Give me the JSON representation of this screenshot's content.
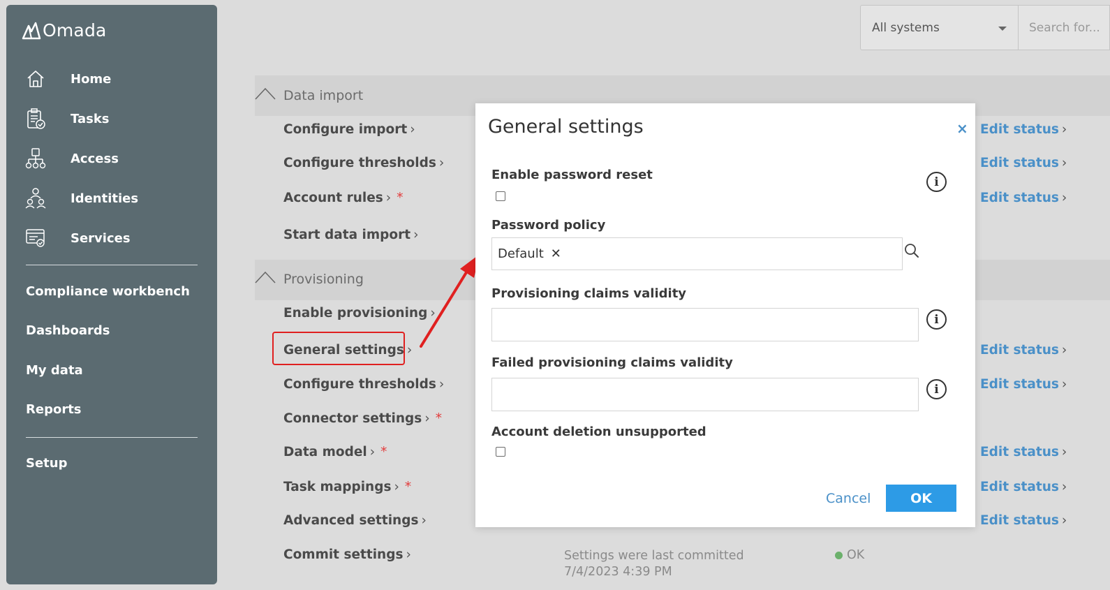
{
  "sidebar": {
    "brand": "Omada",
    "nav": [
      {
        "label": "Home",
        "icon": "home-icon"
      },
      {
        "label": "Tasks",
        "icon": "tasks-icon"
      },
      {
        "label": "Access",
        "icon": "access-icon"
      },
      {
        "label": "Identities",
        "icon": "identities-icon"
      },
      {
        "label": "Services",
        "icon": "services-icon"
      }
    ],
    "links": [
      "Compliance workbench",
      "Dashboards",
      "My data",
      "Reports"
    ],
    "setup": "Setup"
  },
  "topbar": {
    "system_select": "All systems",
    "search_placeholder": "Search for..."
  },
  "sections": {
    "data_import": {
      "title": "Data import",
      "items": [
        "Configure import",
        "Configure thresholds",
        "Account rules",
        "Start data import"
      ]
    },
    "provisioning": {
      "title": "Provisioning",
      "items": [
        "Enable provisioning",
        "General settings",
        "Configure thresholds",
        "Connector settings",
        "Data model",
        "Task mappings",
        "Advanced settings",
        "Commit settings"
      ]
    }
  },
  "edit_status_label": "Edit status",
  "chevron": "›",
  "required_mark": "*",
  "commit": {
    "line1": "Settings were last committed",
    "line2": "7/4/2023 4:39 PM",
    "status": "OK"
  },
  "modal": {
    "title": "General settings",
    "close": "×",
    "fields": {
      "enable_password_reset": "Enable password reset",
      "password_policy": "Password policy",
      "password_policy_value": "Default",
      "remove_mark": "✕",
      "provisioning_claims_validity": "Provisioning claims validity",
      "failed_provisioning_claims_validity": "Failed provisioning claims validity",
      "account_deletion_unsupported": "Account deletion unsupported"
    },
    "info_glyph": "i",
    "cancel": "Cancel",
    "ok": "OK"
  },
  "colors": {
    "sidebar": "#5b6b71",
    "link": "#4a90c8",
    "primary_button": "#2d9be6",
    "required": "#e23b3b",
    "annotation": "#e02020",
    "ok_dot": "#6bb06b"
  }
}
